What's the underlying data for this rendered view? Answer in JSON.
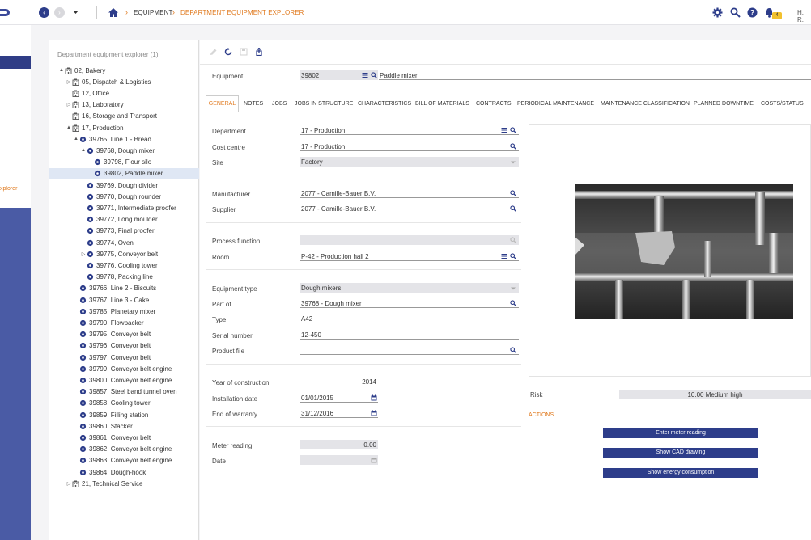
{
  "topbar": {
    "breadcrumb": [
      "EQUIPMENT",
      "DEPARTMENT EQUIPMENT EXPLORER"
    ],
    "notification_count": "4",
    "user_initials": "H. R."
  },
  "appnav": {
    "partial_label": "xplorer"
  },
  "tree": {
    "title": "Department equipment explorer (1)",
    "items": [
      {
        "toggle": "▲",
        "icon": "building",
        "label": "02, Bakery"
      },
      {
        "toggle": "▷",
        "icon": "building",
        "label": "05, Dispatch & Logistics"
      },
      {
        "toggle": "",
        "icon": "building",
        "label": "12, Office"
      },
      {
        "toggle": "▷",
        "icon": "building",
        "label": "13, Laboratory"
      },
      {
        "toggle": "",
        "icon": "building",
        "label": "16, Storage and Transport"
      },
      {
        "toggle": "▲",
        "icon": "building",
        "label": "17, Production"
      },
      {
        "toggle": "▲",
        "icon": "gear",
        "label": "39765, Line 1 - Bread"
      },
      {
        "toggle": "▲",
        "icon": "gear",
        "label": "39768, Dough mixer"
      },
      {
        "toggle": "",
        "icon": "gear",
        "label": "39798, Flour silo"
      },
      {
        "toggle": "",
        "icon": "gear",
        "label": "39802, Paddle mixer"
      },
      {
        "toggle": "",
        "icon": "gear",
        "label": "39769, Dough divider"
      },
      {
        "toggle": "",
        "icon": "gear",
        "label": "39770, Dough rounder"
      },
      {
        "toggle": "",
        "icon": "gear",
        "label": "39771, Intermediate proofer"
      },
      {
        "toggle": "",
        "icon": "gear",
        "label": "39772, Long moulder"
      },
      {
        "toggle": "",
        "icon": "gear",
        "label": "39773, Final proofer"
      },
      {
        "toggle": "",
        "icon": "gear",
        "label": "39774, Oven"
      },
      {
        "toggle": "▷",
        "icon": "gear",
        "label": "39775, Conveyor belt"
      },
      {
        "toggle": "",
        "icon": "gear",
        "label": "39776, Cooling tower"
      },
      {
        "toggle": "",
        "icon": "gear",
        "label": "39778, Packing line"
      },
      {
        "toggle": "",
        "icon": "gear",
        "label": "39766, Line 2 - Biscuits"
      },
      {
        "toggle": "",
        "icon": "gear",
        "label": "39767, Line 3 - Cake"
      },
      {
        "toggle": "",
        "icon": "gear",
        "label": "39785, Planetary mixer"
      },
      {
        "toggle": "",
        "icon": "gear",
        "label": "39790, Flowpacker"
      },
      {
        "toggle": "",
        "icon": "gear",
        "label": "39795, Conveyor belt"
      },
      {
        "toggle": "",
        "icon": "gear",
        "label": "39796, Conveyor belt"
      },
      {
        "toggle": "",
        "icon": "gear",
        "label": "39797, Conveyor belt"
      },
      {
        "toggle": "",
        "icon": "gear",
        "label": "39799, Conveyor belt engine"
      },
      {
        "toggle": "",
        "icon": "gear",
        "label": "39800, Conveyor belt engine"
      },
      {
        "toggle": "",
        "icon": "gear",
        "label": "39857, Steel band tunnel oven"
      },
      {
        "toggle": "",
        "icon": "gear",
        "label": "39858, Cooling tower"
      },
      {
        "toggle": "",
        "icon": "gear",
        "label": "39859, Filling station"
      },
      {
        "toggle": "",
        "icon": "gear",
        "label": "39860, Stacker"
      },
      {
        "toggle": "",
        "icon": "gear",
        "label": "39861, Conveyor belt"
      },
      {
        "toggle": "",
        "icon": "gear",
        "label": "39862, Conveyor belt engine"
      },
      {
        "toggle": "",
        "icon": "gear",
        "label": "39863, Conveyor belt engine"
      },
      {
        "toggle": "",
        "icon": "gear",
        "label": "39864, Dough-hook"
      },
      {
        "toggle": "▷",
        "icon": "building",
        "label": "21, Technical Service"
      }
    ]
  },
  "equipment": {
    "label": "Equipment",
    "code": "39802",
    "name": "Paddle mixer"
  },
  "tabs": [
    "GENERAL",
    "NOTES",
    "JOBS",
    "JOBS IN STRUCTURE",
    "CHARACTERISTICS",
    "BILL OF MATERIALS",
    "CONTRACTS",
    "PERIODICAL MAINTENANCE",
    "MAINTENANCE CLASSIFICATION",
    "PLANNED DOWNTIME",
    "COSTS/STATUS"
  ],
  "form": {
    "department": {
      "label": "Department",
      "value": "17 - Production"
    },
    "cost_centre": {
      "label": "Cost centre",
      "value": "17 - Production"
    },
    "site": {
      "label": "Site",
      "value": "Factory"
    },
    "manufacturer": {
      "label": "Manufacturer",
      "value": "2077 - Camille-Bauer B.V."
    },
    "supplier": {
      "label": "Supplier",
      "value": "2077 - Camille-Bauer B.V."
    },
    "process_function": {
      "label": "Process function",
      "value": ""
    },
    "room": {
      "label": "Room",
      "value": "P-42 - Production hall 2"
    },
    "equipment_type": {
      "label": "Equipment type",
      "value": "Dough mixers"
    },
    "part_of": {
      "label": "Part of",
      "value": "39768 - Dough mixer"
    },
    "type": {
      "label": "Type",
      "value": "A42"
    },
    "serial_number": {
      "label": "Serial number",
      "value": "12-450"
    },
    "product_file": {
      "label": "Product file",
      "value": ""
    },
    "year_of_construction": {
      "label": "Year of construction",
      "value": "2014"
    },
    "installation_date": {
      "label": "Installation date",
      "value": "01/01/2015"
    },
    "end_of_warranty": {
      "label": "End of warranty",
      "value": "31/12/2016"
    },
    "meter_reading": {
      "label": "Meter reading",
      "value": "0.00"
    },
    "date": {
      "label": "Date",
      "value": ""
    }
  },
  "risk": {
    "label": "Risk",
    "value": "10.00 Medium high"
  },
  "actions": {
    "title": "ACTIONS",
    "buttons": [
      "Enter meter reading",
      "Show CAD drawing",
      "Show energy consumption"
    ]
  },
  "colors": {
    "accent": "#e07a1f",
    "brand": "#2d3d8a",
    "nav": "#4a5ba5"
  }
}
